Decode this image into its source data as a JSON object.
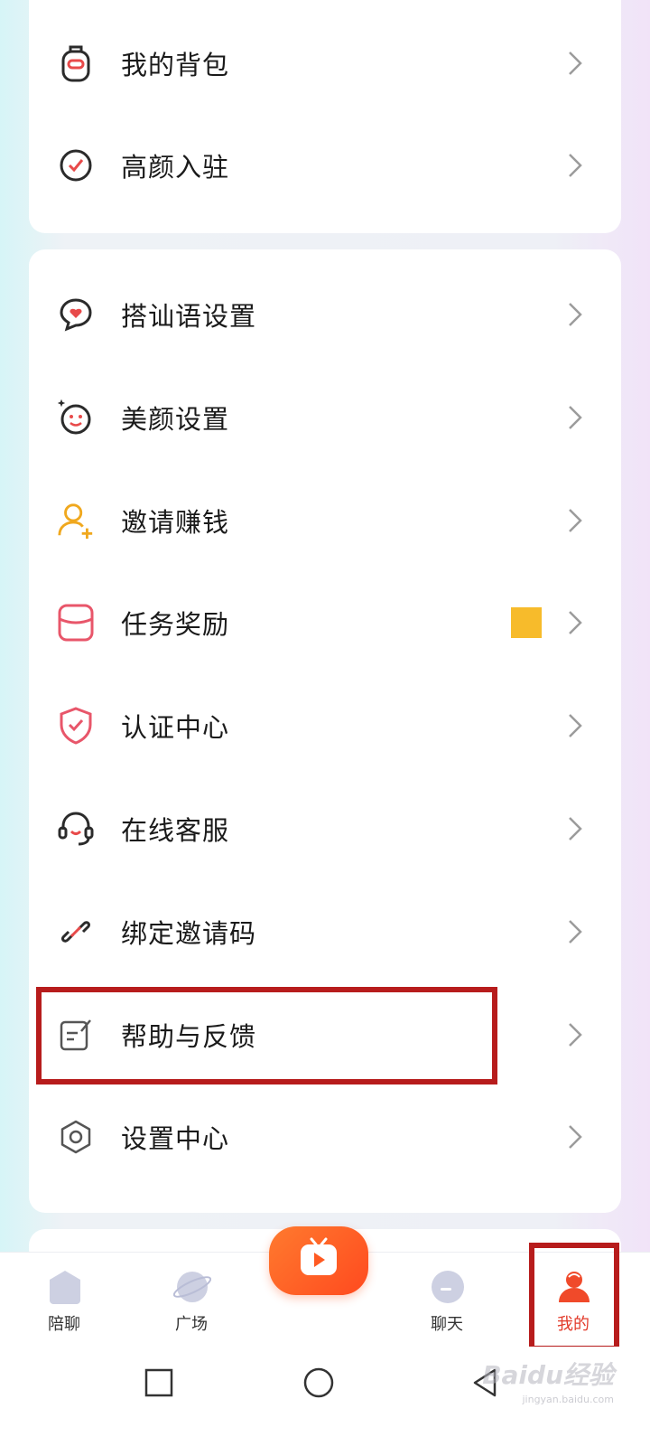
{
  "menu_group_1": [
    {
      "label": "我的背包",
      "icon": "backpack-icon"
    },
    {
      "label": "高颜入驻",
      "icon": "check-circle-icon"
    }
  ],
  "menu_group_2": [
    {
      "label": "搭讪语设置",
      "icon": "chat-heart-icon"
    },
    {
      "label": "美颜设置",
      "icon": "beauty-face-icon"
    },
    {
      "label": "邀请赚钱",
      "icon": "invite-user-icon"
    },
    {
      "label": "任务奖励",
      "icon": "task-reward-icon"
    },
    {
      "label": "认证中心",
      "icon": "shield-check-icon"
    },
    {
      "label": "在线客服",
      "icon": "headset-icon"
    },
    {
      "label": "绑定邀请码",
      "icon": "link-icon"
    },
    {
      "label": "帮助与反馈",
      "icon": "feedback-edit-icon"
    },
    {
      "label": "设置中心",
      "icon": "gear-icon"
    }
  ],
  "tabbar": {
    "tabs": [
      {
        "label": "陪聊",
        "icon": "home-icon"
      },
      {
        "label": "广场",
        "icon": "planet-icon"
      },
      {
        "label": "聊天",
        "icon": "chat-bubble-icon"
      },
      {
        "label": "我的",
        "icon": "profile-icon"
      }
    ],
    "center_icon": "tv-play-icon",
    "active_tab": "我的"
  },
  "watermark": {
    "text": "Baidu经验",
    "sub": "jingyan.baidu.com"
  },
  "colors": {
    "accent": "#ff5a22",
    "highlight": "#b71c1c",
    "badge": "#f7bb2b"
  }
}
